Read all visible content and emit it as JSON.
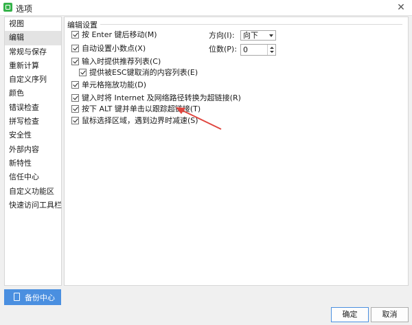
{
  "window": {
    "title": "选项",
    "close_glyph": "✕"
  },
  "sidebar": {
    "items": [
      {
        "label": "视图",
        "selected": false
      },
      {
        "label": "编辑",
        "selected": true
      },
      {
        "label": "常规与保存",
        "selected": false
      },
      {
        "label": "重新计算",
        "selected": false
      },
      {
        "label": "自定义序列",
        "selected": false
      },
      {
        "label": "颜色",
        "selected": false
      },
      {
        "label": "错误检查",
        "selected": false
      },
      {
        "label": "拼写检查",
        "selected": false
      },
      {
        "label": "安全性",
        "selected": false
      },
      {
        "label": "外部内容",
        "selected": false
      },
      {
        "label": "新特性",
        "selected": false
      },
      {
        "label": "信任中心",
        "selected": false
      },
      {
        "label": "自定义功能区",
        "selected": false
      },
      {
        "label": "快速访问工具栏",
        "selected": false
      }
    ],
    "backup_label": "备份中心"
  },
  "panel": {
    "group_title": "编辑设置",
    "options": [
      {
        "label": "按 Enter 键后移动(M)",
        "checked": true
      },
      {
        "label": "自动设置小数点(X)",
        "checked": true
      },
      {
        "label": "输入时提供推荐列表(C)",
        "checked": true
      },
      {
        "label": "提供被ESC键取消的内容列表(E)",
        "checked": true
      },
      {
        "label": "单元格拖放功能(D)",
        "checked": true
      },
      {
        "label": "键入时将 Internet 及网络路径转换为超链接(R)",
        "checked": true
      },
      {
        "label": "按下 ALT 键并单击以跟踪超链接(T)",
        "checked": true
      },
      {
        "label": "鼠标选择区域，遇到边界时减速(S)",
        "checked": true
      }
    ],
    "direction": {
      "label": "方向(I):",
      "value": "向下"
    },
    "decimals": {
      "label": "位数(P):",
      "value": "0"
    },
    "annotation_color": "#e0463f"
  },
  "footer": {
    "ok_label": "确定",
    "cancel_label": "取消"
  },
  "colors": {
    "accent": "#4a8fe0",
    "app_icon": "#35b34a"
  }
}
